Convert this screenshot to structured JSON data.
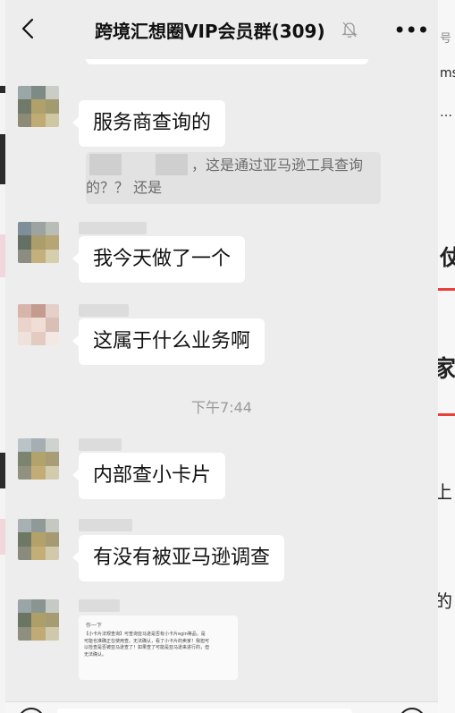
{
  "header": {
    "title": "跨境汇想圈VIP会员群(309)"
  },
  "messages": [
    {
      "text": "服务商查询的"
    },
    {
      "quote": "，这是通过亚马逊工具查询的？？ 还是"
    },
    {
      "text": "我今天做了一个"
    },
    {
      "text": "这属于什么业务啊"
    },
    {
      "time": "下午7:44"
    },
    {
      "text": "内部查小卡片"
    },
    {
      "text": "有没有被亚马逊调查"
    },
    {
      "image_title": "作一下",
      "image_text": "【小卡片法规查询】可查询亚马逊是否有小卡片egin等品，是可能也准确正在使用查。无法确认，看了小卡片的卖家！我担可以检查是否被亚马逊查了！如果查了可能是亚马逊来进行的，但无法确认。"
    }
  ],
  "background": {
    "right_fragments": [
      "号",
      "ms",
      "…",
      "仗",
      "家",
      "上",
      "的"
    ]
  },
  "colors": {
    "chat_bg": "#ededed",
    "bubble": "#ffffff",
    "accent_red": "#e8413c"
  }
}
